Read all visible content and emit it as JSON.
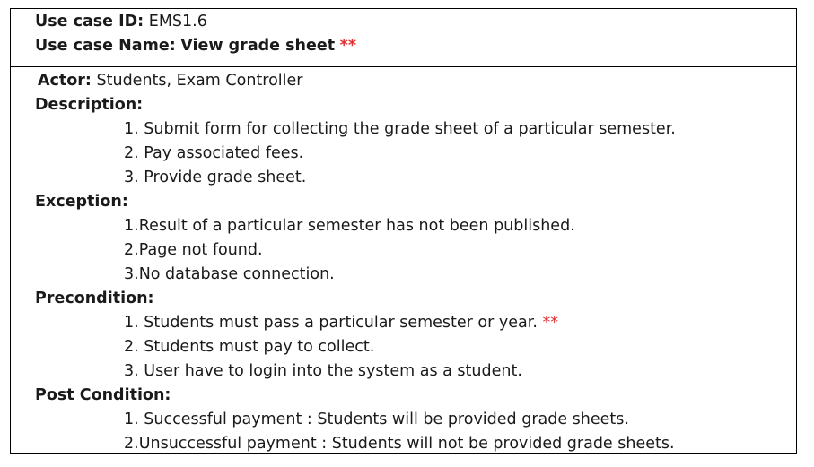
{
  "use_case_id": {
    "label": "Use case ID:",
    "value": "EMS1.6"
  },
  "use_case_name": {
    "label": "Use case Name:",
    "value": "View grade sheet",
    "marker": "**"
  },
  "actor": {
    "label": "Actor:",
    "value": "Students, Exam Controller"
  },
  "description": {
    "label": "Description:",
    "items": [
      "1. Submit form for collecting the grade sheet of a particular semester.",
      "2. Pay associated fees.",
      "3. Provide grade sheet."
    ]
  },
  "exception": {
    "label": "Exception:",
    "items": [
      "1.Result of a particular semester has not been published.",
      "2.Page not found.",
      "3.No database connection."
    ]
  },
  "precondition": {
    "label": "Precondition:",
    "items": [
      "1. Students must pass a particular semester or year.",
      "2. Students must pay to collect.",
      "3. User have to login into the system as a student."
    ],
    "item_marker": "**"
  },
  "post_condition": {
    "label": "Post Condition:",
    "items": [
      "1. Successful payment : Students will be provided grade sheets.",
      "2.Unsuccessful payment : Students will not be provided grade sheets."
    ]
  },
  "colors": {
    "marker": "#e03030",
    "border": "#000000",
    "text": "#1a1a1a"
  }
}
